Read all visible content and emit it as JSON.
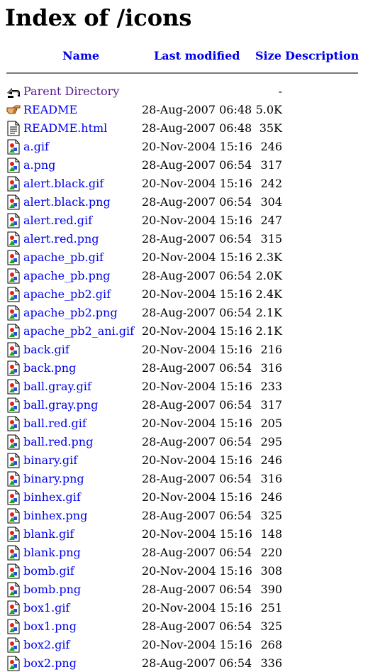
{
  "page": {
    "title": "Index of /icons"
  },
  "table": {
    "headers": {
      "name": "Name",
      "last_modified": "Last modified",
      "size": "Size",
      "description": "Description"
    },
    "parent": {
      "name": "Parent Directory",
      "size": "-",
      "icon": "back-arrow-icon"
    },
    "rows": [
      {
        "name": "README",
        "modified": "28-Aug-2007 06:48",
        "size": "5.0K",
        "icon": "hand-pointing-icon"
      },
      {
        "name": "README.html",
        "modified": "28-Aug-2007 06:48",
        "size": "35K",
        "icon": "text-file-icon"
      },
      {
        "name": "a.gif",
        "modified": "20-Nov-2004 15:16",
        "size": "246",
        "icon": "image-file-icon"
      },
      {
        "name": "a.png",
        "modified": "28-Aug-2007 06:54",
        "size": "317",
        "icon": "image-file-icon"
      },
      {
        "name": "alert.black.gif",
        "modified": "20-Nov-2004 15:16",
        "size": "242",
        "icon": "image-file-icon"
      },
      {
        "name": "alert.black.png",
        "modified": "28-Aug-2007 06:54",
        "size": "304",
        "icon": "image-file-icon"
      },
      {
        "name": "alert.red.gif",
        "modified": "20-Nov-2004 15:16",
        "size": "247",
        "icon": "image-file-icon"
      },
      {
        "name": "alert.red.png",
        "modified": "28-Aug-2007 06:54",
        "size": "315",
        "icon": "image-file-icon"
      },
      {
        "name": "apache_pb.gif",
        "modified": "20-Nov-2004 15:16",
        "size": "2.3K",
        "icon": "image-file-icon"
      },
      {
        "name": "apache_pb.png",
        "modified": "28-Aug-2007 06:54",
        "size": "2.0K",
        "icon": "image-file-icon"
      },
      {
        "name": "apache_pb2.gif",
        "modified": "20-Nov-2004 15:16",
        "size": "2.4K",
        "icon": "image-file-icon"
      },
      {
        "name": "apache_pb2.png",
        "modified": "28-Aug-2007 06:54",
        "size": "2.1K",
        "icon": "image-file-icon"
      },
      {
        "name": "apache_pb2_ani.gif",
        "modified": "20-Nov-2004 15:16",
        "size": "2.1K",
        "icon": "image-file-icon"
      },
      {
        "name": "back.gif",
        "modified": "20-Nov-2004 15:16",
        "size": "216",
        "icon": "image-file-icon"
      },
      {
        "name": "back.png",
        "modified": "28-Aug-2007 06:54",
        "size": "316",
        "icon": "image-file-icon"
      },
      {
        "name": "ball.gray.gif",
        "modified": "20-Nov-2004 15:16",
        "size": "233",
        "icon": "image-file-icon"
      },
      {
        "name": "ball.gray.png",
        "modified": "28-Aug-2007 06:54",
        "size": "317",
        "icon": "image-file-icon"
      },
      {
        "name": "ball.red.gif",
        "modified": "20-Nov-2004 15:16",
        "size": "205",
        "icon": "image-file-icon"
      },
      {
        "name": "ball.red.png",
        "modified": "28-Aug-2007 06:54",
        "size": "295",
        "icon": "image-file-icon"
      },
      {
        "name": "binary.gif",
        "modified": "20-Nov-2004 15:16",
        "size": "246",
        "icon": "image-file-icon"
      },
      {
        "name": "binary.png",
        "modified": "28-Aug-2007 06:54",
        "size": "316",
        "icon": "image-file-icon"
      },
      {
        "name": "binhex.gif",
        "modified": "20-Nov-2004 15:16",
        "size": "246",
        "icon": "image-file-icon"
      },
      {
        "name": "binhex.png",
        "modified": "28-Aug-2007 06:54",
        "size": "325",
        "icon": "image-file-icon"
      },
      {
        "name": "blank.gif",
        "modified": "20-Nov-2004 15:16",
        "size": "148",
        "icon": "image-file-icon"
      },
      {
        "name": "blank.png",
        "modified": "28-Aug-2007 06:54",
        "size": "220",
        "icon": "image-file-icon"
      },
      {
        "name": "bomb.gif",
        "modified": "20-Nov-2004 15:16",
        "size": "308",
        "icon": "image-file-icon"
      },
      {
        "name": "bomb.png",
        "modified": "28-Aug-2007 06:54",
        "size": "390",
        "icon": "image-file-icon"
      },
      {
        "name": "box1.gif",
        "modified": "20-Nov-2004 15:16",
        "size": "251",
        "icon": "image-file-icon"
      },
      {
        "name": "box1.png",
        "modified": "28-Aug-2007 06:54",
        "size": "325",
        "icon": "image-file-icon"
      },
      {
        "name": "box2.gif",
        "modified": "20-Nov-2004 15:16",
        "size": "268",
        "icon": "image-file-icon"
      },
      {
        "name": "box2.png",
        "modified": "28-Aug-2007 06:54",
        "size": "336",
        "icon": "image-file-icon"
      }
    ]
  },
  "colors": {
    "link": "#0000ee",
    "visited": "#551a8b",
    "rule": "#7a7a7a"
  }
}
